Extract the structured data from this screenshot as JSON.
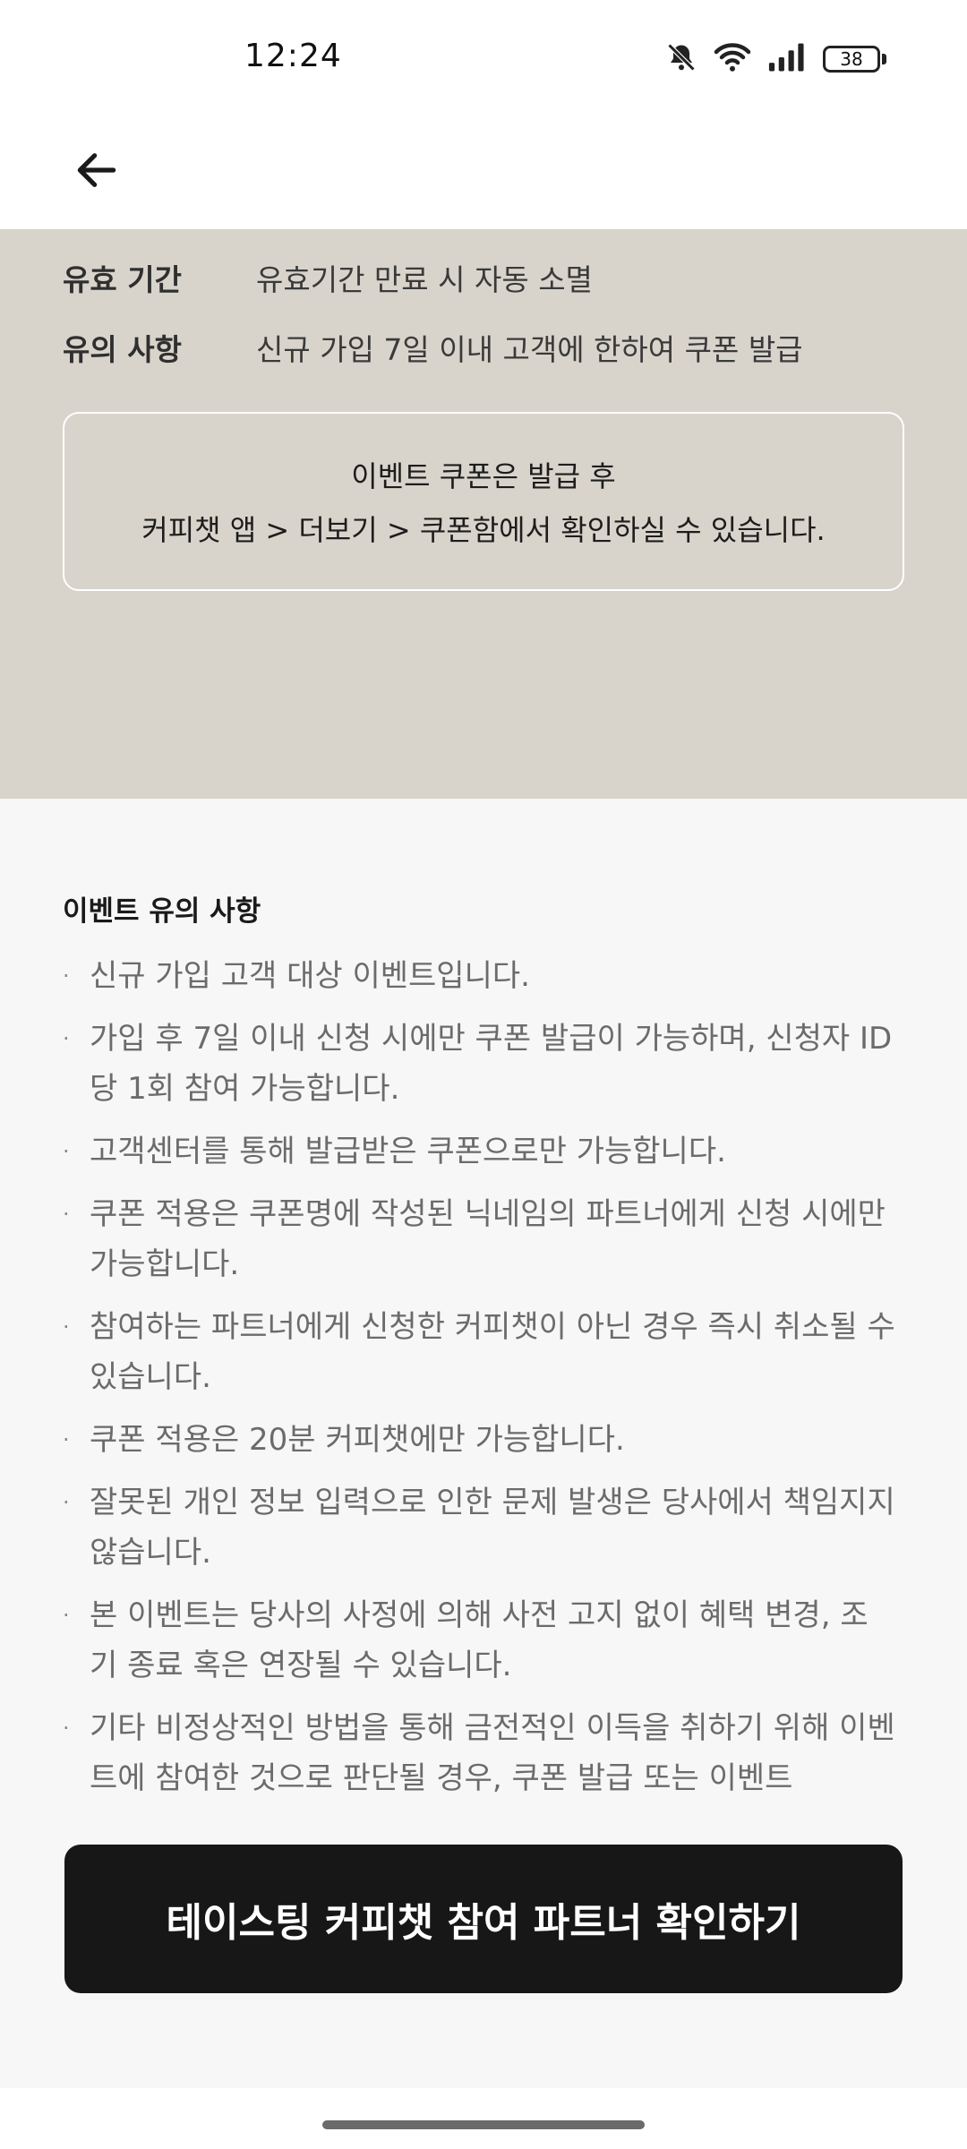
{
  "status_bar": {
    "time": "12:24",
    "battery_level": "38",
    "icons": [
      "mute-bell-icon",
      "wifi-icon",
      "signal-icon",
      "battery-icon"
    ]
  },
  "header": {
    "back_icon": "arrow-left-icon"
  },
  "coupon_info": {
    "rows": [
      {
        "label": "유효 기간",
        "value": "유효기간 만료 시 자동 소멸"
      },
      {
        "label": "유의 사항",
        "value": "신규 가입 7일 이내 고객에 한하여 쿠폰 발급"
      }
    ],
    "notice_lines": [
      "이벤트 쿠폰은 발급 후",
      "커피챗 앱 > 더보기 > 쿠폰함에서 확인하실 수 있습니다."
    ]
  },
  "event_notes": {
    "title": "이벤트 유의 사항",
    "items": [
      "신규 가입 고객 대상 이벤트입니다.",
      "가입 후 7일 이내 신청 시에만 쿠폰 발급이 가능하며, 신청자 ID당 1회 참여 가능합니다.",
      "고객센터를 통해 발급받은 쿠폰으로만 가능합니다.",
      "쿠폰 적용은 쿠폰명에 작성된 닉네임의 파트너에게 신청 시에만 가능합니다.",
      "참여하는 파트너에게 신청한 커피챗이 아닌 경우 즉시 취소될 수 있습니다.",
      "쿠폰 적용은 20분 커피챗에만 가능합니다.",
      "잘못된 개인 정보 입력으로 인한 문제 발생은 당사에서 책임지지 않습니다.",
      "본 이벤트는 당사의 사정에 의해 사전 고지 없이 혜택 변경, 조기 종료 혹은 연장될 수 있습니다.",
      "기타 비정상적인 방법을 통해 금전적인 이득을 취하기 위해 이벤트에 참여한 것으로 판단될 경우, 쿠폰 발급 또는 이벤트"
    ]
  },
  "cta": {
    "label": "테이스팅 커피챗 참여 파트너 확인하기"
  },
  "colors": {
    "panel_bg": "#d9d4cb",
    "cta_bg": "#171717",
    "notes_bg": "#f7f7f7"
  }
}
